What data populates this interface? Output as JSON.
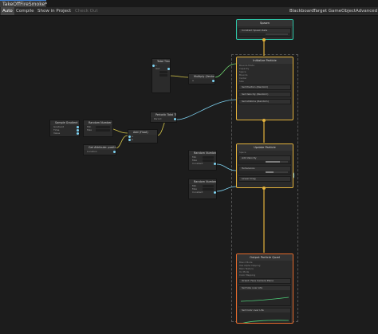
{
  "window": {
    "tab_title": "TakeOffFireSmoke*"
  },
  "toolbar": {
    "auto": "Auto",
    "compile": "Compile",
    "show_in_project": "Show in Project",
    "check_out": "Check Out",
    "blackboard": "Blackboard",
    "target": "Target GameObject",
    "advanced": "Advanced"
  },
  "contexts": {
    "spawn": {
      "title": "Spawn",
      "color": "#2ec4a6",
      "block": "Constant Spawn Rate"
    },
    "initialize": {
      "title": "Initialize Particle",
      "color": "#e3b23c",
      "rows": [
        "Bounds Mode",
        "Capacity",
        "Space",
        "Bounds",
        "Center",
        "Size"
      ],
      "blocks": [
        "Set Position (Random)",
        "Set Velocity (Random)",
        "Set Lifetime (Random)"
      ]
    },
    "update": {
      "title": "Update Particle",
      "color": "#e3b23c",
      "rows": [
        "Space",
        "Update Position",
        "Update Rotation",
        "Age Particles",
        "Reap Particles"
      ],
      "blocks": [
        "Add Velocity",
        "Turbulence",
        "Linear Drag"
      ]
    },
    "output": {
      "title": "Output Particle Quad",
      "color": "#e36a2c",
      "rows": [
        "Blend Mode",
        "Use Alpha Clipping",
        "Main Texture",
        "Uv Mode",
        "Color Mapping"
      ],
      "blocks": [
        "Orient: Face Camera Plane",
        "Set Size over Life",
        "Set Color over Life"
      ]
    }
  },
  "operators": {
    "sample_gradient": {
      "title": "Sample Gradient",
      "rows": [
        "Gradient",
        "Time",
        "Value",
        "Out"
      ]
    },
    "gradient_pos": {
      "title": "Random Number",
      "rows": [
        "Min",
        "Max",
        "Seed",
        "Constant"
      ]
    },
    "vector3": {
      "title": "Add (Float)",
      "rows": [
        "a",
        "b"
      ]
    },
    "time": {
      "title": "Total Time (VFX)",
      "rows": [
        "s",
        "Out"
      ]
    },
    "noise": {
      "title": "Get Attribute: position",
      "rows": [
        "Location",
        "position"
      ]
    },
    "multiply": {
      "title": "Multiply (Vector3)",
      "rows": [
        "a",
        "b",
        "Out"
      ]
    },
    "periodic": {
      "title": "Periodic Total Time",
      "rows": [
        "Period",
        "Range"
      ]
    },
    "get_position": {
      "title": "Get Attribute: position (Current)",
      "rows": [
        "Location"
      ]
    },
    "random_a": {
      "title": "Random Number",
      "rows": [
        "Min",
        "Max",
        "Constant"
      ]
    },
    "random_b": {
      "title": "Random Number",
      "rows": [
        "Min",
        "Max",
        "Constant"
      ]
    }
  }
}
